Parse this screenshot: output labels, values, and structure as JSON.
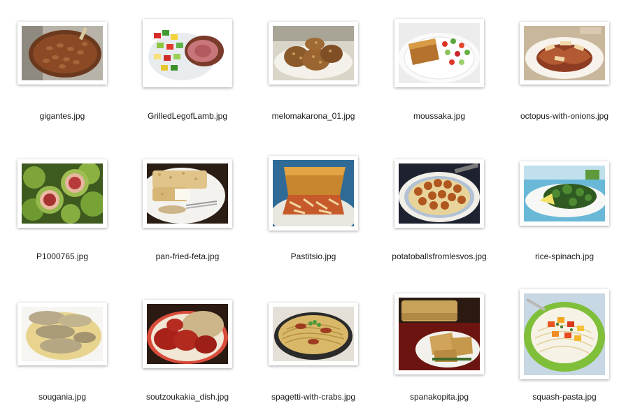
{
  "files": [
    {
      "name": "gigantes.jpg",
      "subject": "baked-beans-dish"
    },
    {
      "name": "GrilledLegofLamb.jpg",
      "subject": "grilled-lamb-salad"
    },
    {
      "name": "melomakarona_01.jpg",
      "subject": "honey-cookies"
    },
    {
      "name": "moussaka.jpg",
      "subject": "moussaka-plate"
    },
    {
      "name": "octopus-with-onions.jpg",
      "subject": "octopus-dish"
    },
    {
      "name": "P1000765.jpg",
      "subject": "figs"
    },
    {
      "name": "pan-fried-feta.jpg",
      "subject": "fried-feta"
    },
    {
      "name": "Pastitsio.jpg",
      "subject": "pastitsio-slice"
    },
    {
      "name": "potatoballsfromlesvos.jpg",
      "subject": "potato-balls"
    },
    {
      "name": "rice-spinach.jpg",
      "subject": "spinach-rice"
    },
    {
      "name": "sougania.jpg",
      "subject": "stuffed-onions"
    },
    {
      "name": "soutzoukakia_dish.jpg",
      "subject": "meatballs-with-rice"
    },
    {
      "name": "spagetti-with-crabs.jpg",
      "subject": "crab-spaghetti"
    },
    {
      "name": "spanakopita.jpg",
      "subject": "spinach-pie"
    },
    {
      "name": "squash-pasta.jpg",
      "subject": "squash-pasta"
    }
  ],
  "colors": {
    "background": "#ffffff",
    "caption": "#1a1a1a",
    "frame": "#ffffff"
  }
}
